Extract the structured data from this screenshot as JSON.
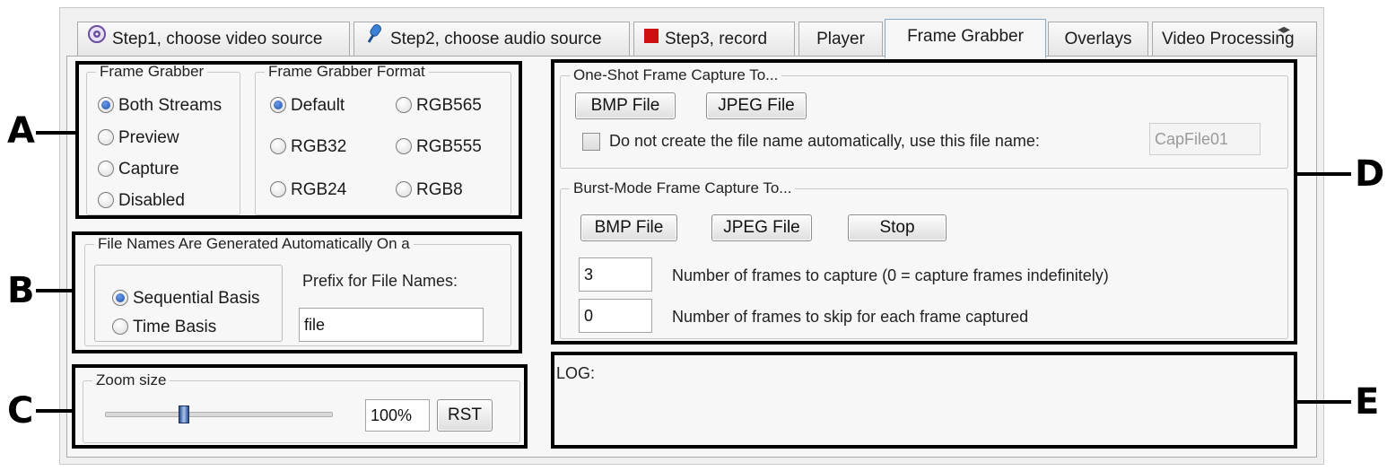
{
  "tabs": [
    {
      "label": "Step1, choose video source",
      "icon": "webcam-icon"
    },
    {
      "label": "Step2, choose audio source",
      "icon": "microphone-icon"
    },
    {
      "label": "Step3, record",
      "icon": "record-stop-icon"
    },
    {
      "label": "Player"
    },
    {
      "label": "Frame Grabber",
      "active": true
    },
    {
      "label": "Overlays"
    },
    {
      "label": "Video Processing"
    }
  ],
  "frame_grabber": {
    "title": "Frame Grabber",
    "options": [
      "Both Streams",
      "Preview",
      "Capture",
      "Disabled"
    ],
    "selected": "Both Streams"
  },
  "format": {
    "title": "Frame Grabber Format",
    "options": [
      "Default",
      "RGB565",
      "RGB32",
      "RGB555",
      "RGB24",
      "RGB8"
    ],
    "selected": "Default"
  },
  "file_names": {
    "title": "File Names Are Generated Automatically On a",
    "options": [
      "Sequential Basis",
      "Time Basis"
    ],
    "selected": "Sequential Basis",
    "prefix_label": "Prefix for File Names:",
    "prefix_value": "file"
  },
  "zoom": {
    "title": "Zoom size",
    "value": "100%",
    "reset_label": "RST",
    "slider_fraction": 0.35
  },
  "one_shot": {
    "title": "One-Shot Frame Capture To...",
    "bmp_label": "BMP File",
    "jpeg_label": "JPEG File",
    "checkbox_label": "Do not create the file name automatically, use this file name:",
    "checkbox_checked": false,
    "filename_value": "CapFile01"
  },
  "burst": {
    "title": "Burst-Mode Frame Capture To...",
    "bmp_label": "BMP File",
    "jpeg_label": "JPEG File",
    "stop_label": "Stop",
    "frames_value": "3",
    "frames_label": "Number of frames to capture (0 = capture frames indefinitely)",
    "skip_value": "0",
    "skip_label": "Number of frames to skip for each frame captured"
  },
  "log": {
    "label": "LOG:"
  },
  "callouts": [
    "A",
    "B",
    "C",
    "D",
    "E"
  ],
  "colors": {
    "highlight": "#000000",
    "radio_selected": "#1f4fa8",
    "record_icon": "#d01010"
  }
}
